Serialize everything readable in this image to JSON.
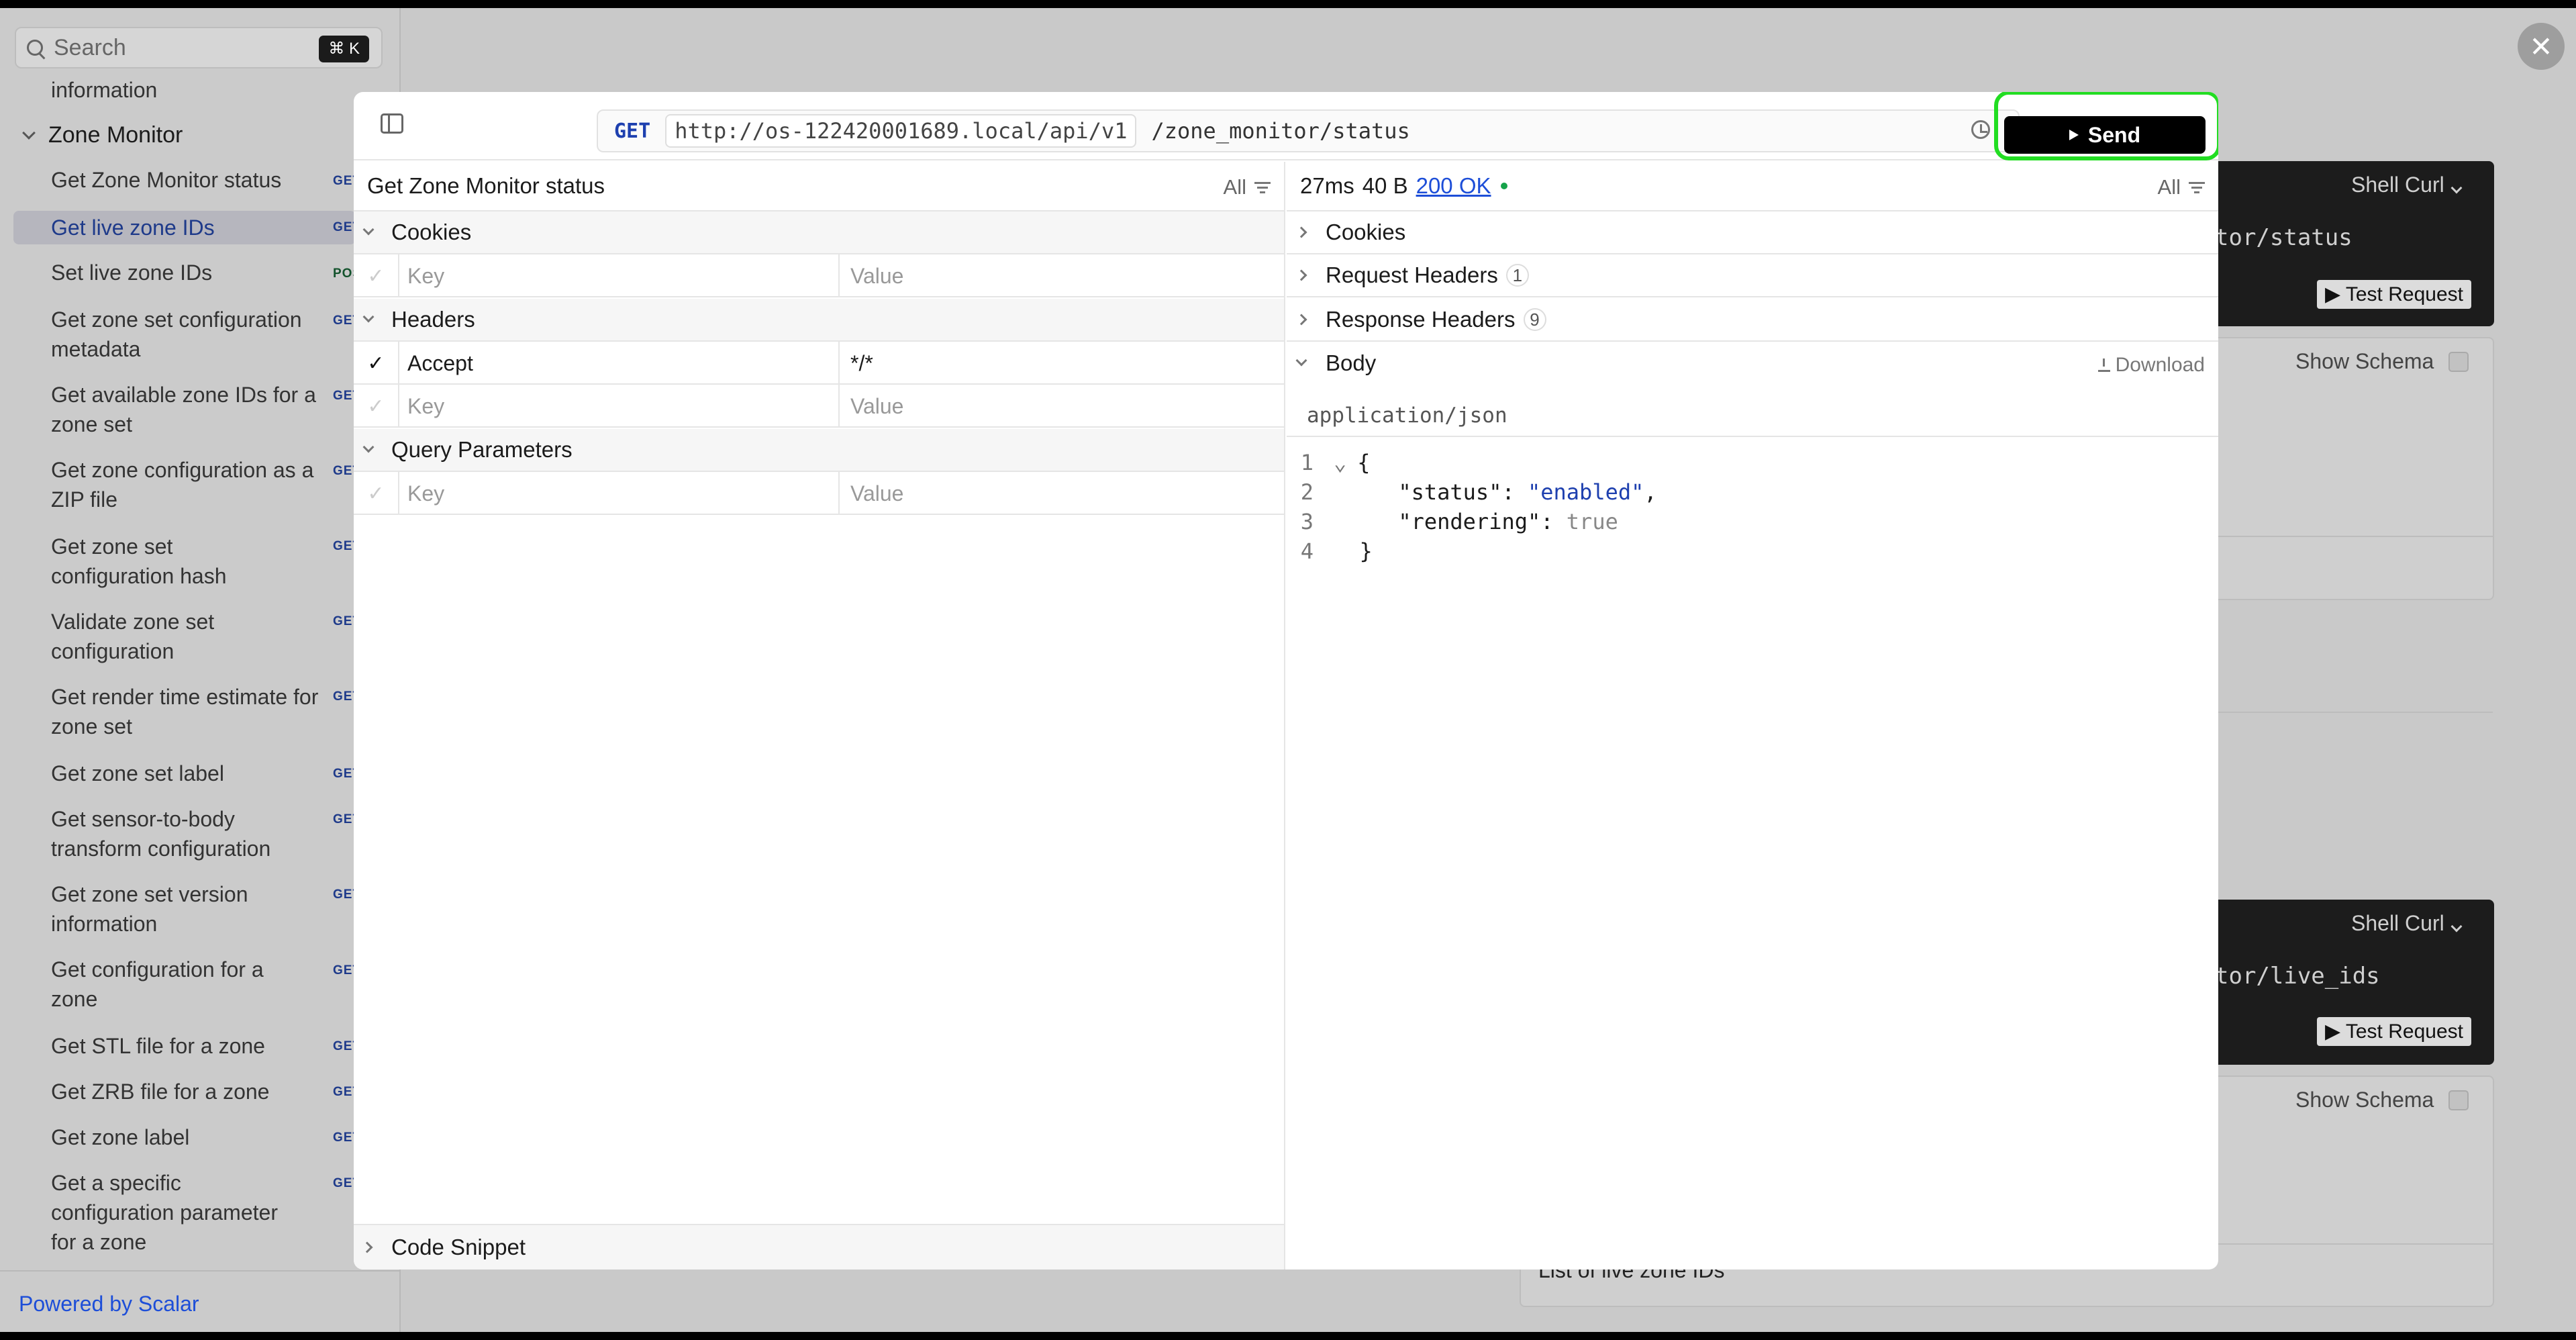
{
  "sidebar": {
    "search_placeholder": "Search",
    "search_shortcut": "⌘ K",
    "partial_item": "information",
    "group_title": "Zone Monitor",
    "items": [
      {
        "label": "Get Zone Monitor status",
        "method": "GET"
      },
      {
        "label": "Get live zone IDs",
        "method": "GET",
        "active": true
      },
      {
        "label": "Set live zone IDs",
        "method": "POST"
      },
      {
        "label": "Get zone set configuration metadata",
        "method": "GET"
      },
      {
        "label": "Get available zone IDs for a zone set",
        "method": "GET"
      },
      {
        "label": "Get zone configuration as a ZIP file",
        "method": "GET"
      },
      {
        "label": "Get zone set configuration hash",
        "method": "GET"
      },
      {
        "label": "Validate zone set configuration",
        "method": "GET"
      },
      {
        "label": "Get render time estimate for zone set",
        "method": "GET"
      },
      {
        "label": "Get zone set label",
        "method": "GET"
      },
      {
        "label": "Get sensor-to-body transform configuration",
        "method": "GET"
      },
      {
        "label": "Get zone set version information",
        "method": "GET"
      },
      {
        "label": "Get configuration for a zone",
        "method": "GET"
      },
      {
        "label": "Get STL file for a zone",
        "method": "GET"
      },
      {
        "label": "Get ZRB file for a zone",
        "method": "GET"
      },
      {
        "label": "Get zone label",
        "method": "GET"
      },
      {
        "label": "Get a specific configuration parameter for a zone",
        "method": "GET"
      }
    ],
    "powered_by": "Powered by Scalar"
  },
  "background": {
    "shell_label": "Shell Curl",
    "code_1": "tor/status",
    "code_2": "tor/live_ids",
    "test_request": "Test Request",
    "show_schema": "Show Schema",
    "live_ids_desc": "List of live zone IDs"
  },
  "request": {
    "method": "GET",
    "server": "http://os-122420001689.local/api/v1",
    "path": "/zone_monitor/status",
    "send_label": "Send",
    "title": "Get Zone Monitor status",
    "filter_label": "All",
    "sections": {
      "cookies": "Cookies",
      "headers": "Headers",
      "query": "Query Parameters",
      "code_snippet": "Code Snippet"
    },
    "key_placeholder": "Key",
    "value_placeholder": "Value",
    "header_key": "Accept",
    "header_value": "*/*"
  },
  "response": {
    "time": "27ms",
    "size": "40 B",
    "status": "200 OK",
    "filter_label": "All",
    "cookies": "Cookies",
    "request_headers": "Request Headers",
    "request_headers_count": "1",
    "response_headers": "Response Headers",
    "response_headers_count": "9",
    "body": "Body",
    "download": "Download",
    "mime": "application/json",
    "lines": [
      {
        "n": "1",
        "text": "{"
      },
      {
        "n": "2",
        "key": "\"status\"",
        "val": "\"enabled\"",
        "end": ","
      },
      {
        "n": "3",
        "key": "\"rendering\"",
        "bool": "true"
      },
      {
        "n": "4",
        "text": "}"
      }
    ]
  }
}
